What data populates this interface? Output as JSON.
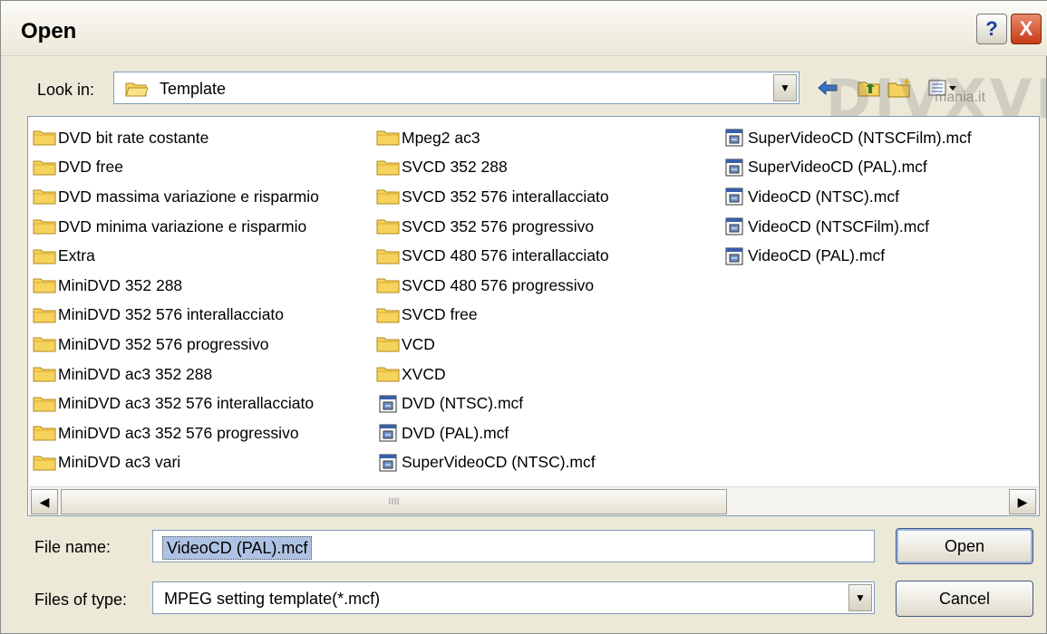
{
  "window": {
    "title": "Open"
  },
  "look_in": {
    "label": "Look in:",
    "value": "Template"
  },
  "file_list": {
    "columns": [
      [
        {
          "name": "DVD bit rate costante",
          "type": "folder"
        },
        {
          "name": "DVD free",
          "type": "folder"
        },
        {
          "name": "DVD massima variazione e risparmio",
          "type": "folder"
        },
        {
          "name": "DVD minima variazione e risparmio",
          "type": "folder"
        },
        {
          "name": "Extra",
          "type": "folder"
        },
        {
          "name": "MiniDVD 352 288",
          "type": "folder"
        },
        {
          "name": "MiniDVD 352 576 interallacciato",
          "type": "folder"
        },
        {
          "name": "MiniDVD 352 576 progressivo",
          "type": "folder"
        },
        {
          "name": "MiniDVD ac3 352 288",
          "type": "folder"
        },
        {
          "name": "MiniDVD ac3 352 576 interallacciato",
          "type": "folder"
        },
        {
          "name": "MiniDVD ac3 352 576 progressivo",
          "type": "folder"
        },
        {
          "name": "MiniDVD ac3 vari",
          "type": "folder"
        }
      ],
      [
        {
          "name": "Mpeg2 ac3",
          "type": "folder"
        },
        {
          "name": "SVCD 352 288",
          "type": "folder"
        },
        {
          "name": "SVCD 352 576 interallacciato",
          "type": "folder"
        },
        {
          "name": "SVCD 352 576 progressivo",
          "type": "folder"
        },
        {
          "name": "SVCD 480 576 interallacciato",
          "type": "folder"
        },
        {
          "name": "SVCD 480 576 progressivo",
          "type": "folder"
        },
        {
          "name": "SVCD free",
          "type": "folder"
        },
        {
          "name": "VCD",
          "type": "folder"
        },
        {
          "name": "XVCD",
          "type": "folder"
        },
        {
          "name": "DVD (NTSC).mcf",
          "type": "file"
        },
        {
          "name": "DVD (PAL).mcf",
          "type": "file"
        },
        {
          "name": "SuperVideoCD (NTSC).mcf",
          "type": "file"
        }
      ],
      [
        {
          "name": "SuperVideoCD (NTSCFilm).mcf",
          "type": "file"
        },
        {
          "name": "SuperVideoCD (PAL).mcf",
          "type": "file"
        },
        {
          "name": "VideoCD (NTSC).mcf",
          "type": "file"
        },
        {
          "name": "VideoCD (NTSCFilm).mcf",
          "type": "file"
        },
        {
          "name": "VideoCD (PAL).mcf",
          "type": "file"
        }
      ]
    ]
  },
  "scrollbar": {
    "grip": "IIII"
  },
  "file_name": {
    "label": "File name:",
    "value": "VideoCD (PAL).mcf"
  },
  "file_type": {
    "label": "Files of type:",
    "value": "MPEG setting template(*.mcf)"
  },
  "buttons": {
    "open": "Open",
    "cancel": "Cancel",
    "help": "?",
    "close": "X"
  },
  "watermark": {
    "text": "DIVXVIC",
    "sub": "mania.it"
  },
  "colors": {
    "folder": "#f6d35c",
    "selection": "#aec3e3",
    "close_button": "#c93a16"
  }
}
